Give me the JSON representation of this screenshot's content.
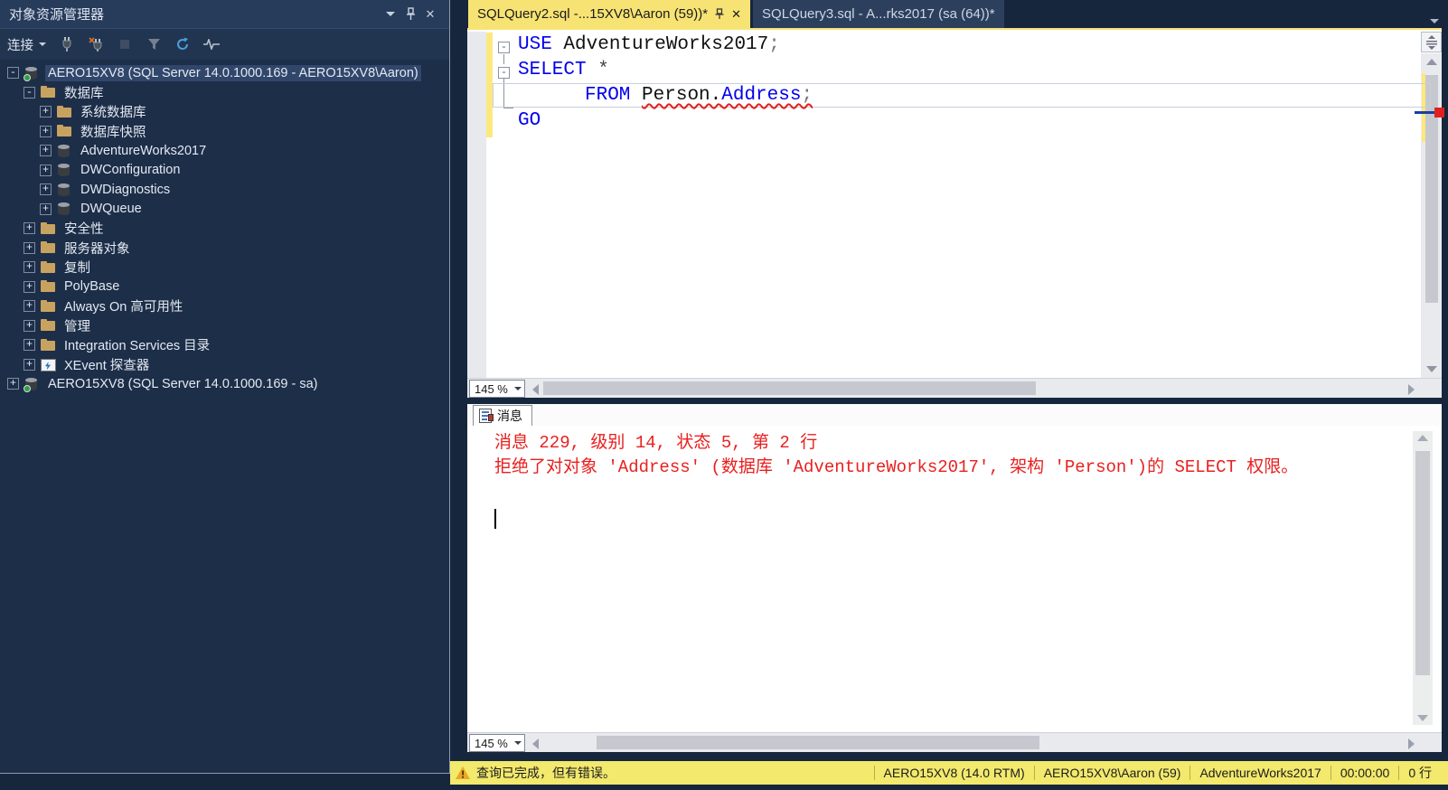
{
  "object_explorer": {
    "title": "对象资源管理器",
    "icons": {
      "chevron": "▾",
      "pin": "pin",
      "close": "✕"
    },
    "toolbar": {
      "connect_label": "连接"
    },
    "tree": [
      {
        "label": "AERO15XV8 (SQL Server 14.0.1000.169 - AERO15XV8\\Aaron)",
        "expander": "-",
        "icon": "server"
      },
      {
        "label": "数据库",
        "expander": "-",
        "icon": "folder"
      },
      {
        "label": "系统数据库",
        "expander": "+",
        "icon": "folder"
      },
      {
        "label": "数据库快照",
        "expander": "+",
        "icon": "folder"
      },
      {
        "label": "AdventureWorks2017",
        "expander": "+",
        "icon": "database"
      },
      {
        "label": "DWConfiguration",
        "expander": "+",
        "icon": "database"
      },
      {
        "label": "DWDiagnostics",
        "expander": "+",
        "icon": "database"
      },
      {
        "label": "DWQueue",
        "expander": "+",
        "icon": "database"
      },
      {
        "label": "安全性",
        "expander": "+",
        "icon": "folder"
      },
      {
        "label": "服务器对象",
        "expander": "+",
        "icon": "folder"
      },
      {
        "label": "复制",
        "expander": "+",
        "icon": "folder"
      },
      {
        "label": "PolyBase",
        "expander": "+",
        "icon": "folder"
      },
      {
        "label": "Always On 高可用性",
        "expander": "+",
        "icon": "folder"
      },
      {
        "label": "管理",
        "expander": "+",
        "icon": "folder"
      },
      {
        "label": "Integration Services 目录",
        "expander": "+",
        "icon": "folder"
      },
      {
        "label": "XEvent 探查器",
        "expander": "+",
        "icon": "xevent"
      },
      {
        "label": "AERO15XV8 (SQL Server 14.0.1000.169 - sa)",
        "expander": "+",
        "icon": "server"
      }
    ]
  },
  "tabs": {
    "active": {
      "label": "SQLQuery2.sql -...15XV8\\Aaron (59))*",
      "close": "✕"
    },
    "inactive": {
      "label": "SQLQuery3.sql - A...rks2017 (sa (64))*"
    }
  },
  "editor": {
    "code": {
      "line1": {
        "kw": "USE",
        "text": " AdventureWorks2017",
        "punct": ";"
      },
      "line2": {
        "kw": "SELECT",
        "op": " *"
      },
      "line3": {
        "kw": "FROM",
        "space": " ",
        "obj": "Person.",
        "obj2": "Address",
        "punct": ";"
      },
      "line4": {
        "kw": "GO"
      }
    },
    "outline_collapse_glyph": "-",
    "zoom": "145 %"
  },
  "messages": {
    "tab_label": "消息",
    "line1": "消息 229, 级别 14, 状态 5, 第 2 行",
    "line2": "拒绝了对对象 'Address' (数据库 'AdventureWorks2017', 架构 'Person')的 SELECT 权限。",
    "zoom": "145 %"
  },
  "status_bar": {
    "message": "查询已完成，但有错误。",
    "server": "AERO15XV8 (14.0 RTM)",
    "user": "AERO15XV8\\Aaron (59)",
    "database": "AdventureWorks2017",
    "time": "00:00:00",
    "rows": "0 行"
  },
  "colors": {
    "accent_yellow": "#f7e373",
    "status_yellow": "#f2e96d",
    "error_red": "#e3201e",
    "keyword_blue": "#0000ee",
    "panel_navy": "#1d2e49"
  }
}
